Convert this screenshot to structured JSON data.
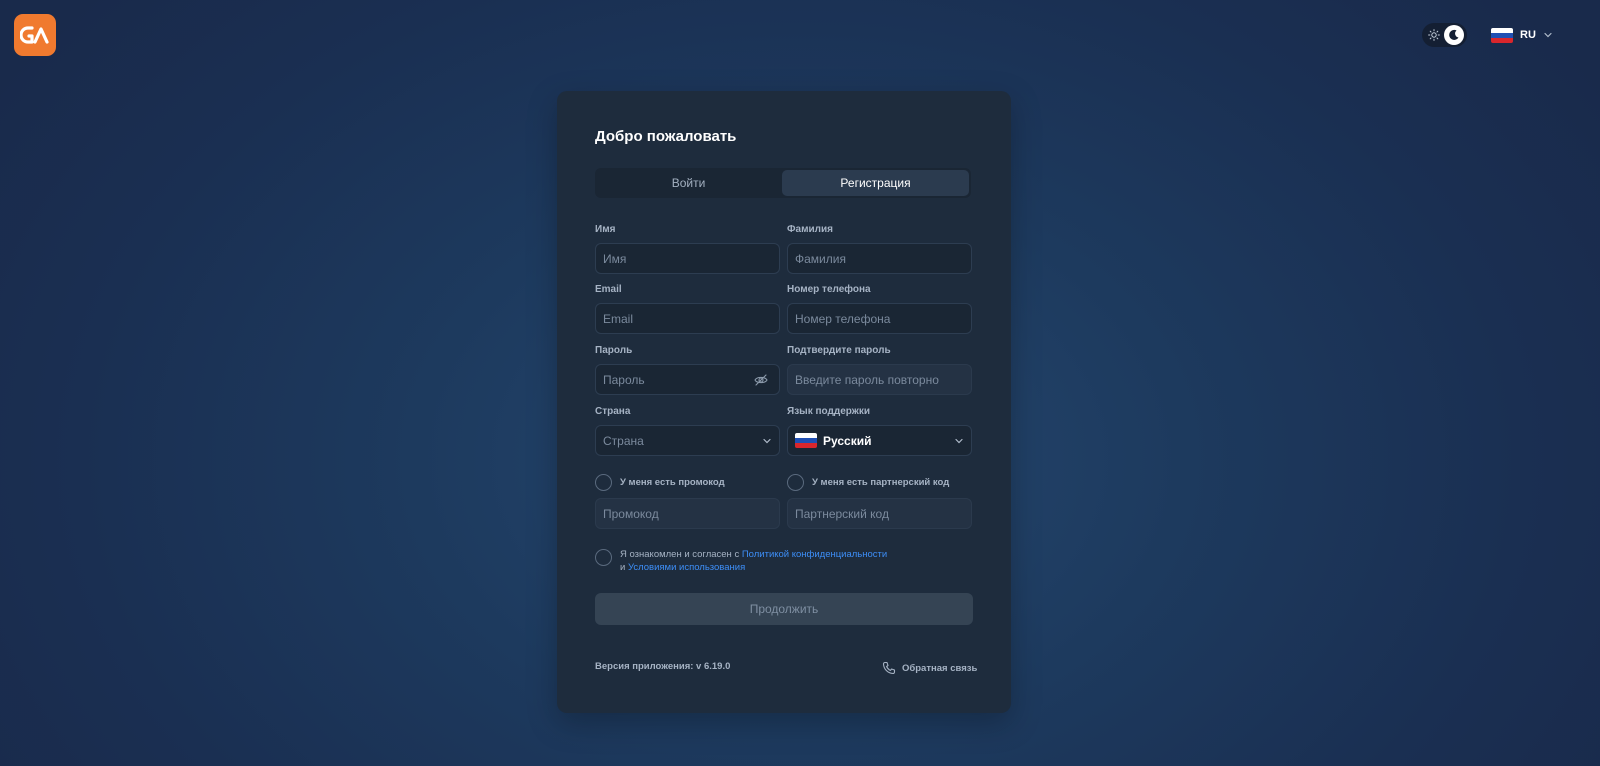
{
  "header": {
    "logo_icon": "ga-logo-icon",
    "theme_toggle": {
      "light_icon": "sun-icon",
      "dark_icon": "moon-icon",
      "selected": "dark"
    },
    "language": {
      "code": "RU",
      "flag_icon": "russia-flag-icon"
    }
  },
  "card": {
    "title": "Добро пожаловать",
    "tabs": [
      {
        "label": "Войти",
        "active": false
      },
      {
        "label": "Регистрация",
        "active": true
      }
    ],
    "fields": {
      "first_name": {
        "label": "Имя",
        "placeholder": "Имя",
        "value": ""
      },
      "last_name": {
        "label": "Фамилия",
        "placeholder": "Фамилия",
        "value": ""
      },
      "email": {
        "label": "Email",
        "placeholder": "Email",
        "value": ""
      },
      "phone": {
        "label": "Номер телефона",
        "placeholder": "Номер телефона",
        "value": ""
      },
      "password": {
        "label": "Пароль",
        "placeholder": "Пароль",
        "value": "",
        "toggle_icon": "eye-off-icon"
      },
      "confirm_password": {
        "label": "Подтвердите пароль",
        "placeholder": "Введите пароль повторно",
        "value": ""
      },
      "country": {
        "label": "Страна",
        "placeholder": "Страна",
        "selected": ""
      },
      "support_language": {
        "label": "Язык поддержки",
        "selected": "Русский",
        "flag_icon": "russia-flag-icon"
      }
    },
    "promo": {
      "checkbox_label": "У меня есть промокод",
      "placeholder": "Промокод",
      "checked": false
    },
    "partner": {
      "checkbox_label": "У меня есть партнерский код",
      "placeholder": "Партнерский код",
      "checked": false
    },
    "terms": {
      "prefix": "Я ознакомлен и согласен с ",
      "privacy_link": "Политикой конфиденциальности",
      "and": "и ",
      "terms_link": "Условиями использования",
      "checked": false
    },
    "continue_label": "Продолжить",
    "version": "Версия приложения: v 6.19.0",
    "feedback_label": "Обратная связь",
    "feedback_icon": "phone-icon"
  },
  "colors": {
    "accent_orange": "#f07a2f",
    "link_blue": "#3d8ef7",
    "card_bg": "#1e2c3d"
  }
}
